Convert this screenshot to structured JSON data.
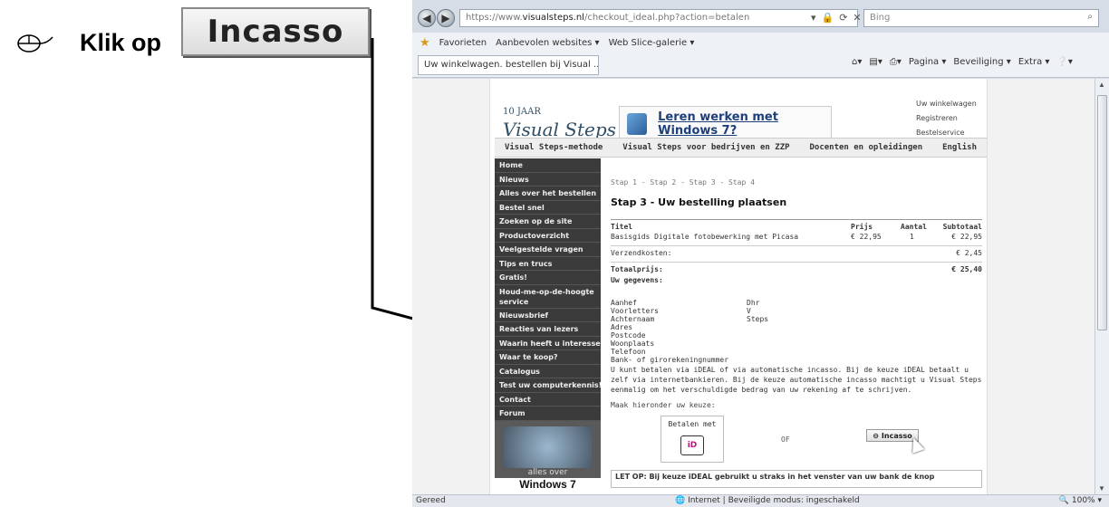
{
  "instruction": {
    "bullet_icon": "mouse-icon",
    "text": "Klik op",
    "button_label": "Incasso"
  },
  "browser": {
    "address": {
      "prefix": "https://www.",
      "host": "visualsteps.nl",
      "path": "/checkout_ideal.php?action=betalen"
    },
    "search_placeholder": "Bing",
    "favorites": {
      "label": "Favorieten",
      "item1": "Aanbevolen websites ▾",
      "item2": "Web Slice-galerie ▾"
    },
    "tab_title": "Uw winkelwagen. bestellen bij Visual ...",
    "command_bar": [
      "Pagina ▾",
      "Beveiliging ▾",
      "Extra ▾"
    ],
    "status": {
      "left": "Gereed",
      "middle": "Internet | Beveiligde modus: ingeschakeld",
      "zoom": "100%"
    }
  },
  "site": {
    "logo_years": "10 JAAR",
    "logo_name": "Visual Steps",
    "banner_text": "Leren werken met Windows 7?",
    "top_links": [
      "Uw winkelwagen",
      "Registreren",
      "Bestelservice"
    ],
    "nav": [
      "Visual Steps-methode",
      "Visual Steps voor bedrijven en ZZP",
      "Docenten en opleidingen",
      "English"
    ],
    "menu": [
      "Home",
      "Nieuws",
      "Alles over het bestellen",
      "Bestel snel",
      "Zoeken op de site",
      "Productoverzicht",
      "Veelgestelde vragen",
      "Tips en trucs",
      "Gratis!",
      "Houd-me-op-de-hoogte service",
      "Nieuwsbrief",
      "Reacties van lezers",
      "Waarin heeft u interesse?",
      "Waar te koop?",
      "Catalogus",
      "Test uw computerkennis!",
      "Contact",
      "Forum"
    ],
    "promo_caption": "alles over",
    "promo_title": "Windows 7"
  },
  "checkout": {
    "steps": "Stap 1 - Stap 2 - Stap 3 - Stap 4",
    "heading": "Stap 3 - Uw bestelling plaatsen",
    "headers": [
      "Titel",
      "Prijs",
      "Aantal",
      "Subtotaal"
    ],
    "item": {
      "title": "Basisgids Digitale fotobewerking met Picasa",
      "price": "€ 22,95",
      "qty": "1",
      "subtotal": "€ 22,95"
    },
    "shipping_label": "Verzendkosten:",
    "shipping_value": "€ 2,45",
    "total_label": "Totaalprijs:",
    "total_value": "€ 25,40",
    "details_heading": "Uw gegevens:",
    "fields": [
      {
        "label": "Aanhef",
        "value": "Dhr"
      },
      {
        "label": "Voorletters",
        "value": "V"
      },
      {
        "label": "Achternaam",
        "value": "Steps"
      },
      {
        "label": "Adres",
        "value": ""
      },
      {
        "label": "Postcode",
        "value": ""
      },
      {
        "label": "Woonplaats",
        "value": ""
      },
      {
        "label": "Telefoon",
        "value": ""
      },
      {
        "label": "Bank- of girorekeningnummer",
        "value": ""
      }
    ],
    "paragraph": "U kunt betalen via iDEAL of via automatische incasso. Bij de keuze iDEAL betaalt u zelf via internetbankieren. Bij de keuze automatische incasso machtigt u Visual Steps eenmalig om het verschuldigde bedrag van uw rekening af te schrijven.",
    "choose": "Maak hieronder uw keuze:",
    "pay_ideal_label": "Betalen met",
    "ideal_logo": "iD",
    "or": "OF",
    "incasso_button": "Incasso",
    "tip": "LET OP: Bij keuze iDEAL gebruikt u straks in het venster van uw bank de knop"
  }
}
